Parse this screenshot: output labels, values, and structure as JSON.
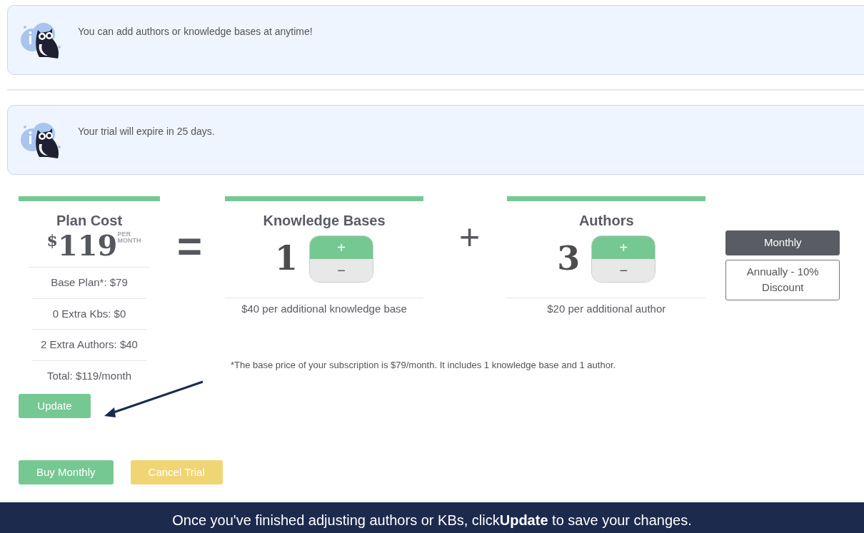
{
  "notices": [
    {
      "text": "You can add authors or knowledge bases at anytime!"
    },
    {
      "text": "Your trial will expire in 25 days."
    }
  ],
  "plan_cost": {
    "title": "Plan Cost",
    "currency": "$",
    "amount": "119",
    "period": "PER MONTH",
    "lines": [
      "Base Plan*: $79",
      "0 Extra Kbs: $0",
      "2 Extra Authors: $40",
      "Total: $119/month"
    ],
    "update_button": "Update"
  },
  "equals": "=",
  "counters": [
    {
      "title": "Knowledge Bases",
      "value": "1",
      "plus": "+",
      "minus": "−",
      "note": "$40 per additional knowledge base"
    },
    {
      "title": "Authors",
      "value": "3",
      "plus": "+",
      "minus": "−",
      "note": "$20 per additional author"
    }
  ],
  "plus_sign": "+",
  "footnote": "*The base price of your subscription is $79/month. It includes 1 knowledge base and 1 author.",
  "billing": [
    {
      "label": "Monthly",
      "selected": true
    },
    {
      "label": "Annually - 10% Discount",
      "selected": false
    }
  ],
  "actions": [
    {
      "label": "Buy Monthly",
      "kind": "primary"
    },
    {
      "label": "Cancel Trial",
      "kind": "warning"
    }
  ],
  "banner": "Once you've finished adjusting authors or KBs, click**Update** to save your changes."
}
